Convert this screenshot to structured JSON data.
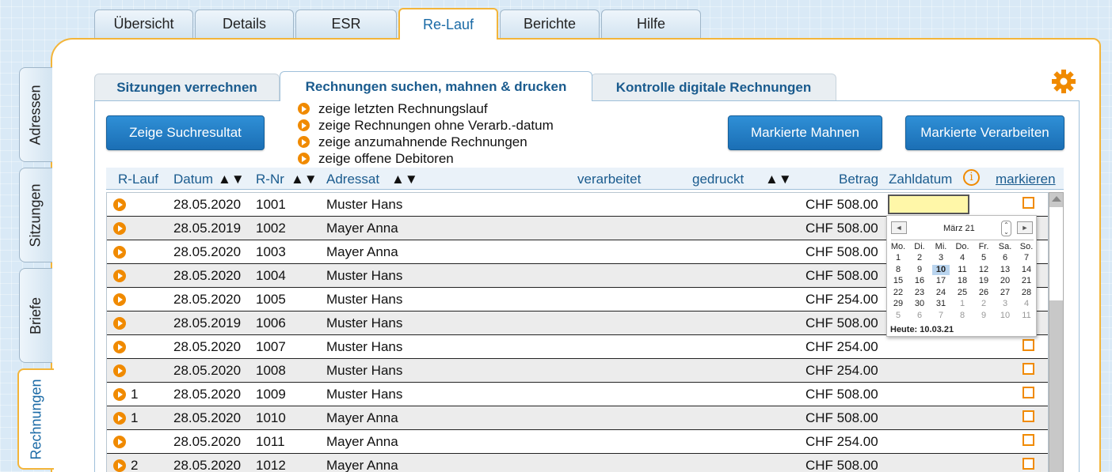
{
  "top_tabs": [
    {
      "label": "Übersicht",
      "active": false
    },
    {
      "label": "Details",
      "active": false
    },
    {
      "label": "ESR",
      "active": false
    },
    {
      "label": "Re-Lauf",
      "active": true
    },
    {
      "label": "Berichte",
      "active": false
    },
    {
      "label": "Hilfe",
      "active": false
    }
  ],
  "side_tabs": [
    {
      "label": "Adressen",
      "active": false
    },
    {
      "label": "Sitzungen",
      "active": false
    },
    {
      "label": "Briefe",
      "active": false
    },
    {
      "label": "Rechnungen",
      "active": true
    }
  ],
  "sub_tabs": [
    {
      "label": "Sitzungen verrechnen",
      "active": false
    },
    {
      "label": "Rechnungen suchen, mahnen & drucken",
      "active": true
    },
    {
      "label": "Kontrolle digitale Rechnungen",
      "active": false
    }
  ],
  "buttons": {
    "search": "Zeige Suchresultat",
    "dun": "Markierte Mahnen",
    "process": "Markierte Verarbeiten"
  },
  "options": [
    "zeige letzten Rechnungslauf",
    "zeige Rechnungen ohne Verarb.-datum",
    "zeige anzumahnende Rechnungen",
    "zeige offene Debitoren"
  ],
  "columns": {
    "rlauf": "R-Lauf",
    "datum": "Datum",
    "rnr": "R-Nr",
    "adressat": "Adressat",
    "verarbeitet": "verarbeitet",
    "gedruckt": "gedruckt",
    "betrag": "Betrag",
    "zahldatum": "Zahldatum",
    "markieren": "markieren",
    "sort_glyph": "▲▼",
    "info_glyph": "i"
  },
  "rows": [
    {
      "rlauf": "",
      "datum": "28.05.2020",
      "rnr": "1001",
      "adressat": "Muster Hans",
      "betrag": "CHF 508.00"
    },
    {
      "rlauf": "",
      "datum": "28.05.2019",
      "rnr": "1002",
      "adressat": "Mayer Anna",
      "betrag": "CHF 508.00"
    },
    {
      "rlauf": "",
      "datum": "28.05.2020",
      "rnr": "1003",
      "adressat": "Mayer Anna",
      "betrag": "CHF 508.00"
    },
    {
      "rlauf": "",
      "datum": "28.05.2020",
      "rnr": "1004",
      "adressat": "Muster Hans",
      "betrag": "CHF 508.00"
    },
    {
      "rlauf": "",
      "datum": "28.05.2020",
      "rnr": "1005",
      "adressat": "Muster Hans",
      "betrag": "CHF 254.00"
    },
    {
      "rlauf": "",
      "datum": "28.05.2019",
      "rnr": "1006",
      "adressat": "Muster Hans",
      "betrag": "CHF 508.00"
    },
    {
      "rlauf": "",
      "datum": "28.05.2020",
      "rnr": "1007",
      "adressat": "Muster Hans",
      "betrag": "CHF 254.00"
    },
    {
      "rlauf": "",
      "datum": "28.05.2020",
      "rnr": "1008",
      "adressat": "Muster Hans",
      "betrag": "CHF 254.00"
    },
    {
      "rlauf": "1",
      "datum": "28.05.2020",
      "rnr": "1009",
      "adressat": "Muster Hans",
      "betrag": "CHF 508.00"
    },
    {
      "rlauf": "1",
      "datum": "28.05.2020",
      "rnr": "1010",
      "adressat": "Mayer Anna",
      "betrag": "CHF 508.00"
    },
    {
      "rlauf": "",
      "datum": "28.05.2020",
      "rnr": "1011",
      "adressat": "Mayer Anna",
      "betrag": "CHF 254.00"
    },
    {
      "rlauf": "2",
      "datum": "28.05.2020",
      "rnr": "1012",
      "adressat": "Mayer Anna",
      "betrag": "CHF 508.00"
    }
  ],
  "calendar": {
    "month": "März 21",
    "prev": "◄",
    "next": "►",
    "spin_up": "⌃",
    "spin_down": "⌄",
    "weekdays": [
      "Mo.",
      "Di.",
      "Mi.",
      "Do.",
      "Fr.",
      "Sa.",
      "So."
    ],
    "weeks": [
      [
        {
          "d": "1",
          "g": false
        },
        {
          "d": "2",
          "g": false
        },
        {
          "d": "3",
          "g": false
        },
        {
          "d": "4",
          "g": false
        },
        {
          "d": "5",
          "g": false
        },
        {
          "d": "6",
          "g": false
        },
        {
          "d": "7",
          "g": false
        }
      ],
      [
        {
          "d": "8",
          "g": false
        },
        {
          "d": "9",
          "g": false
        },
        {
          "d": "10",
          "g": false,
          "today": true
        },
        {
          "d": "11",
          "g": false
        },
        {
          "d": "12",
          "g": false
        },
        {
          "d": "13",
          "g": false
        },
        {
          "d": "14",
          "g": false
        }
      ],
      [
        {
          "d": "15",
          "g": false
        },
        {
          "d": "16",
          "g": false
        },
        {
          "d": "17",
          "g": false
        },
        {
          "d": "18",
          "g": false
        },
        {
          "d": "19",
          "g": false
        },
        {
          "d": "20",
          "g": false
        },
        {
          "d": "21",
          "g": false
        }
      ],
      [
        {
          "d": "22",
          "g": false
        },
        {
          "d": "23",
          "g": false
        },
        {
          "d": "24",
          "g": false
        },
        {
          "d": "25",
          "g": false
        },
        {
          "d": "26",
          "g": false
        },
        {
          "d": "27",
          "g": false
        },
        {
          "d": "28",
          "g": false
        }
      ],
      [
        {
          "d": "29",
          "g": false
        },
        {
          "d": "30",
          "g": false
        },
        {
          "d": "31",
          "g": false
        },
        {
          "d": "1",
          "g": true
        },
        {
          "d": "2",
          "g": true
        },
        {
          "d": "3",
          "g": true
        },
        {
          "d": "4",
          "g": true
        }
      ],
      [
        {
          "d": "5",
          "g": true
        },
        {
          "d": "6",
          "g": true
        },
        {
          "d": "7",
          "g": true
        },
        {
          "d": "8",
          "g": true
        },
        {
          "d": "9",
          "g": true
        },
        {
          "d": "10",
          "g": true
        },
        {
          "d": "11",
          "g": true
        }
      ]
    ],
    "today_label": "Heute: 10.03.21"
  },
  "colors": {
    "accent": "#f3b53a",
    "button": "#1b6fb5",
    "orange": "#f08a00",
    "header_text": "#1a5b8e"
  }
}
